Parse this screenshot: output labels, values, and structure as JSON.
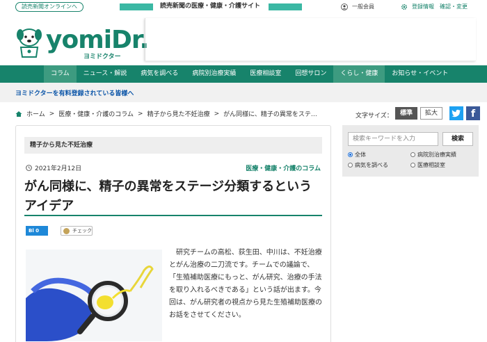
{
  "topbar": {
    "online_label": "読売新聞オンラインへ",
    "site_title": "読売新聞の医療・健康・介護サイト",
    "member_label": "一般会員",
    "account_label": "登録情報　確認・変更"
  },
  "header": {
    "logo_text": "yomiDr.",
    "logo_sub": "ヨミドクター"
  },
  "nav": {
    "items": [
      {
        "label": "コラム"
      },
      {
        "label": "ニュース・解説"
      },
      {
        "label": "病気を調べる"
      },
      {
        "label": "病院別治療実績"
      },
      {
        "label": "医療相談室"
      },
      {
        "label": "回想サロン"
      },
      {
        "label": "くらし・健康"
      },
      {
        "label": "お知らせ・イベント"
      }
    ]
  },
  "notice": "ヨミドクターを有料登録されている皆様へ",
  "breadcrumb": {
    "home": "ホーム",
    "sep": ">",
    "crumb1": "医療・健康・介護のコラム",
    "crumb2": "精子から見た不妊治療",
    "crumb3": "がん同様に、精子の異常をステ…"
  },
  "fontsize": {
    "label": "文字サイズ：",
    "standard": "標準",
    "large": "拡大"
  },
  "article": {
    "series": "精子から見た不妊治療",
    "date": "2021年2月12日",
    "category": "医療・健康・介護のコラム",
    "title": "がん同様に、精子の異常をステージ分類するというアイデア",
    "bl_count": "Bl  0",
    "check_label": "チェック",
    "body": "研究チームの高松、荻生田、中川は、不妊治療とがん治療の二刀流です。チームでの議論で、「生殖補助医療にもっと、がん研究、治療の手法を取り入れるべきである」という話が出ます。今回は、がん研究者の視点から見た生殖補助医療のお話をさせてください。"
  },
  "sidebar": {
    "search_placeholder": "検索キーワードを入力",
    "search_button": "検索",
    "radios": [
      {
        "label": "全体",
        "checked": true
      },
      {
        "label": "病院別治療実績",
        "checked": false
      },
      {
        "label": "病気を調べる",
        "checked": false
      },
      {
        "label": "医療相談室",
        "checked": false
      }
    ]
  },
  "colors": {
    "brand": "#17836b",
    "link": "#0b55a8"
  }
}
